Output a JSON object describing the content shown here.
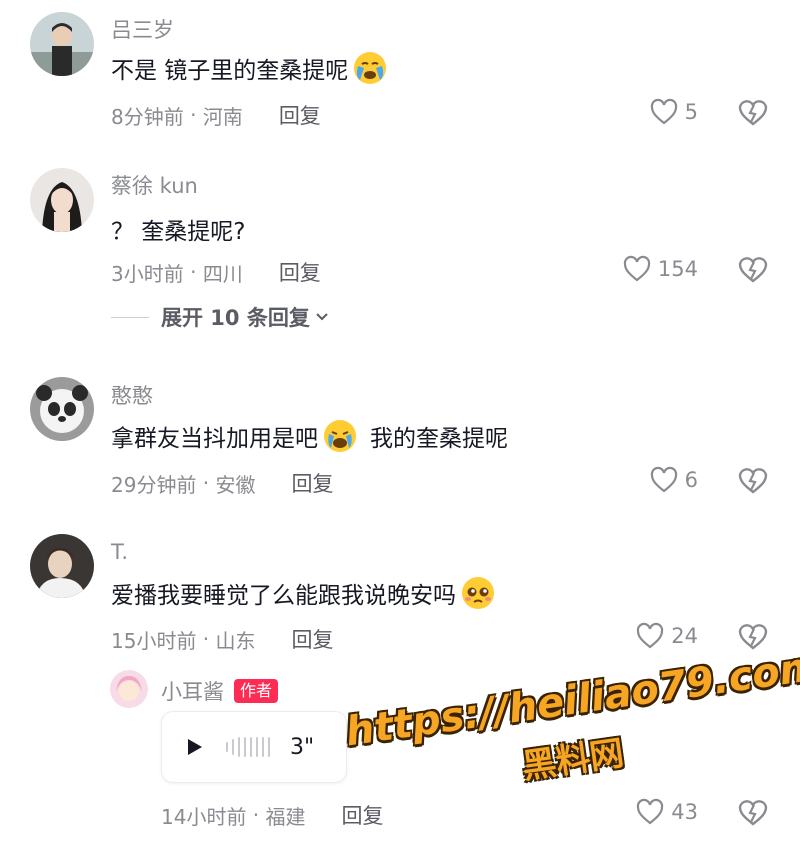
{
  "comments": [
    {
      "username": "吕三岁",
      "text": "不是 镜子里的奎桑提呢",
      "emoji": "crying-face",
      "time": "8分钟前",
      "location": "河南",
      "reply_label": "回复",
      "likes": "5"
    },
    {
      "username": "蔡徐 kun",
      "text": "？ 奎桑提呢?",
      "time": "3小时前",
      "location": "四川",
      "reply_label": "回复",
      "likes": "154",
      "expand_label": "展开 10 条回复"
    },
    {
      "username": "憨憨",
      "text_before": "拿群友当抖加用是吧",
      "emoji": "crying-face",
      "text_after": "我的奎桑提呢",
      "time": "29分钟前",
      "location": "安徽",
      "reply_label": "回复",
      "likes": "6"
    },
    {
      "username": "T.",
      "text": "爱播我要睡觉了么能跟我说晚安吗",
      "emoji": "pleading-face",
      "time": "15小时前",
      "location": "山东",
      "reply_label": "回复",
      "likes": "24",
      "reply": {
        "username": "小耳酱",
        "author_tag": "作者",
        "voice_duration": "3\"",
        "time": "14小时前",
        "location": "福建",
        "reply_label": "回复",
        "likes": "43"
      }
    }
  ],
  "watermark": {
    "url": "https://heiliao79.com",
    "name": "黑料网"
  },
  "colors": {
    "text": "#161823",
    "meta": "#8a8b91",
    "author_tag": "#fe2c55",
    "watermark": "#f6a623"
  }
}
